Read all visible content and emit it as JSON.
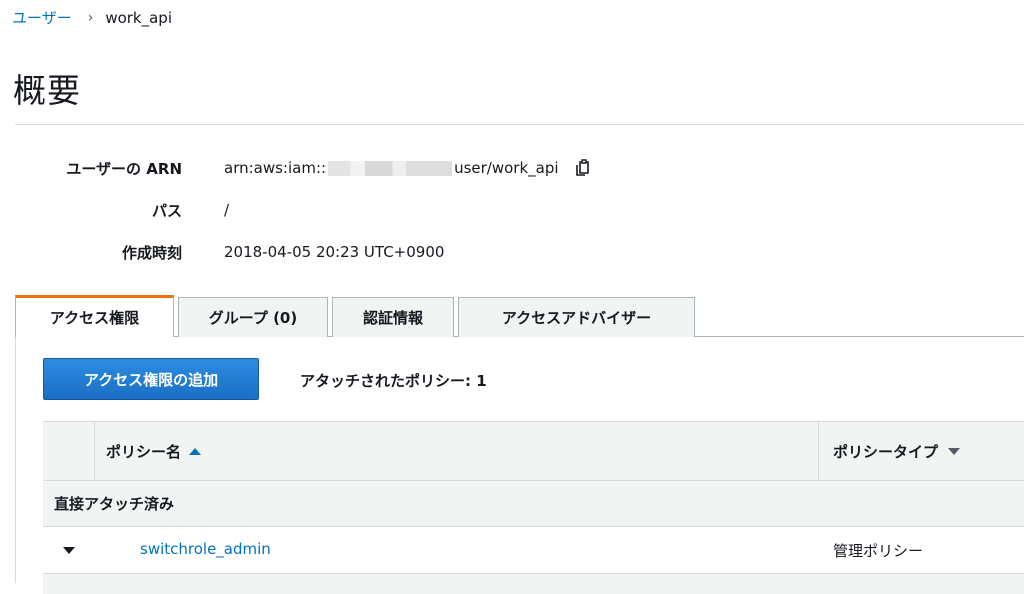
{
  "breadcrumb": {
    "parent": "ユーザー",
    "separator": "›",
    "current": "work_api"
  },
  "page": {
    "title": "概要"
  },
  "summary": {
    "arn": {
      "label": "ユーザーの ARN",
      "prefix": "arn:aws:iam::",
      "suffix": "user/work_api"
    },
    "path": {
      "label": "パス",
      "value": "/"
    },
    "created": {
      "label": "作成時刻",
      "value": "2018-04-05 20:23 UTC+0900"
    }
  },
  "tabs": [
    {
      "label": "アクセス権限",
      "active": true
    },
    {
      "label": "グループ (0)",
      "active": false
    },
    {
      "label": "認証情報",
      "active": false
    },
    {
      "label": "アクセスアドバイザー",
      "active": false
    }
  ],
  "permissions": {
    "add_button": "アクセス権限の追加",
    "attached_count": "アタッチされたポリシー: 1",
    "table": {
      "col_name": "ポリシー名",
      "col_type": "ポリシータイプ",
      "group_label": "直接アタッチ済み",
      "rows": [
        {
          "name": "switchrole_admin",
          "type": "管理ポリシー"
        }
      ]
    }
  },
  "colors": {
    "link": "#0073bb",
    "primary": "#1a6fc4",
    "tab_accent": "#ec7211"
  }
}
